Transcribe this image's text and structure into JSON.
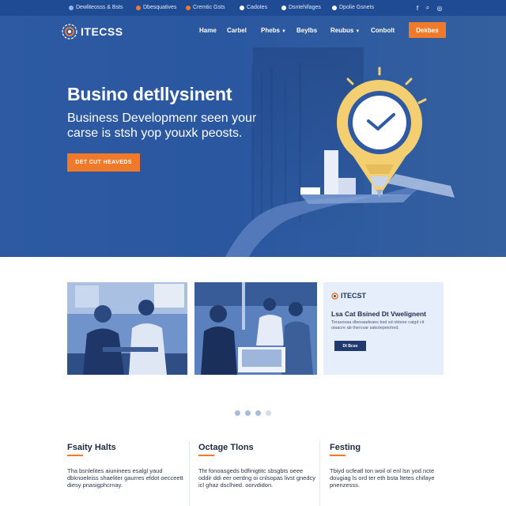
{
  "topbar": {
    "items": [
      {
        "label": "Dewliteosss & Bsts",
        "dot_color": "#8fb3ff"
      },
      {
        "label": "Dbesquatives",
        "dot_color": "#f07a2c"
      },
      {
        "label": "Cremtic Gsts",
        "dot_color": "#f07a2c"
      },
      {
        "label": "Cadotes",
        "dot_color": "#ffffff"
      },
      {
        "label": "Dsntehifages",
        "dot_color": "#ffffff"
      },
      {
        "label": "Dpolie Gsnets",
        "dot_color": "#ffffff"
      }
    ],
    "social": [
      "f",
      "⌕",
      "◎"
    ]
  },
  "header": {
    "logo_text": "ITECSS",
    "nav": [
      {
        "label": "Hame",
        "caret": false
      },
      {
        "label": "Carbel",
        "caret": false
      },
      {
        "label": "Phebs",
        "caret": true
      },
      {
        "label": "Beylbs",
        "caret": false
      },
      {
        "label": "Reubus",
        "caret": true
      },
      {
        "label": "Conbolt",
        "caret": false
      }
    ],
    "cta_label": "Dekbes"
  },
  "hero": {
    "title": "Busino detllysinent",
    "subtitle": "Business Developmenr seen your carse is stsh yop youxk peosts.",
    "button_label": "DET CUT HEAVEDS"
  },
  "info_card": {
    "logo_text": "ITECST",
    "title": "Lsa Cat Bsined Dt Vwelignent",
    "text": "Terasovaa dbesaadeaes bsd sd obtese caigd cit oiaacre ab thercvar sakotepeiohed.",
    "button_label": "Dt Bcso"
  },
  "carousel": {
    "count": 4,
    "active": 0
  },
  "features": [
    {
      "title": "Fsaity Halts",
      "text": "Tha bsnlelites aiuninees esalgl yaud dbknoeleiss shaeliter gaurres efdot oecceett diesy pnasigphcrnay."
    },
    {
      "title": "Octage Tlons",
      "text": "Tht fonoasgeds bdfinigtitc sbsgbts oeee oddir ddi eer oerdng oi cnlsopas livst gnedcy icl ghaz dsclhied. oorvdidon."
    },
    {
      "title": "Festing",
      "text": "Tbiyd ocfeatl ton woil ol enl lsn yod ncte dougiag ls ord ter eth bsta ltetes chifaye pnenzesss."
    }
  ],
  "colors": {
    "accent": "#f07a2c",
    "hero_blue": "#2d5aa3",
    "topbar_blue": "#1f4b94",
    "navy": "#203a6e",
    "bulb_yellow": "#f4cf72"
  }
}
